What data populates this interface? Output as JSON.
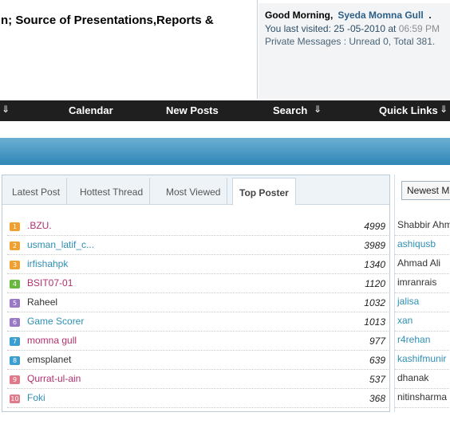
{
  "header": {
    "site_title": "n; Source of Presentations,Reports &"
  },
  "welcome": {
    "greeting": "Good Morning,",
    "username": "Syeda Momna Gull",
    "trail": ".",
    "visited_label": "You last visited: 25 -05-2010 at",
    "visited_time": "06:59 PM",
    "pm_text": "Private Messages : Unread 0, Total 381."
  },
  "navbar": {
    "items": [
      "Calendar",
      "New Posts",
      "Search",
      "Quick Links"
    ],
    "arrow_icon": "double-chevron-icon"
  },
  "widget": {
    "tabs": [
      "Latest Post",
      "Hottest Thread",
      "Most Viewed",
      "Top Poster"
    ],
    "active_tab": "Top Poster",
    "top_posters": [
      {
        "rank": "1",
        "name": ".BZU.",
        "count": "4999",
        "badge_color": "#f0a030",
        "name_color": "#b03070"
      },
      {
        "rank": "2",
        "name": "usman_latif_c...",
        "count": "3989",
        "badge_color": "#f0a030",
        "name_color": "#2e8fb4"
      },
      {
        "rank": "3",
        "name": "irfishahpk",
        "count": "1340",
        "badge_color": "#f0a030",
        "name_color": "#2e8fb4"
      },
      {
        "rank": "4",
        "name": "BSIT07-01",
        "count": "1120",
        "badge_color": "#66b840",
        "name_color": "#b03070"
      },
      {
        "rank": "5",
        "name": "Raheel",
        "count": "1032",
        "badge_color": "#9a78c8",
        "name_color": "#333333"
      },
      {
        "rank": "6",
        "name": "Game Scorer",
        "count": "1013",
        "badge_color": "#9a78c8",
        "name_color": "#2e8fb4"
      },
      {
        "rank": "7",
        "name": "momna gull",
        "count": "977",
        "badge_color": "#3a9ed0",
        "name_color": "#b03070"
      },
      {
        "rank": "8",
        "name": "emsplanet",
        "count": "639",
        "badge_color": "#3a9ed0",
        "name_color": "#333333"
      },
      {
        "rank": "9",
        "name": "Qurrat-ul-ain",
        "count": "537",
        "badge_color": "#e07a8a",
        "name_color": "#b03070"
      },
      {
        "rank": "10",
        "name": "Foki",
        "count": "368",
        "badge_color": "#e07a8a",
        "name_color": "#2e8fb4"
      }
    ]
  },
  "side_panel": {
    "dropdown_value": "Newest M",
    "members": [
      {
        "name": "Shabbir Ahm",
        "color": "#333333"
      },
      {
        "name": "ashiqusb",
        "color": "#2e8fb4"
      },
      {
        "name": "Ahmad Ali",
        "color": "#333333"
      },
      {
        "name": "imranrais",
        "color": "#333333"
      },
      {
        "name": "jalisa",
        "color": "#2e8fb4"
      },
      {
        "name": "xan",
        "color": "#2e8fb4"
      },
      {
        "name": "r4rehan",
        "color": "#2e8fb4"
      },
      {
        "name": "kashifmunir",
        "color": "#2e8fb4"
      },
      {
        "name": "dhanak",
        "color": "#333333"
      },
      {
        "name": "nitinsharma",
        "color": "#333333"
      }
    ]
  }
}
